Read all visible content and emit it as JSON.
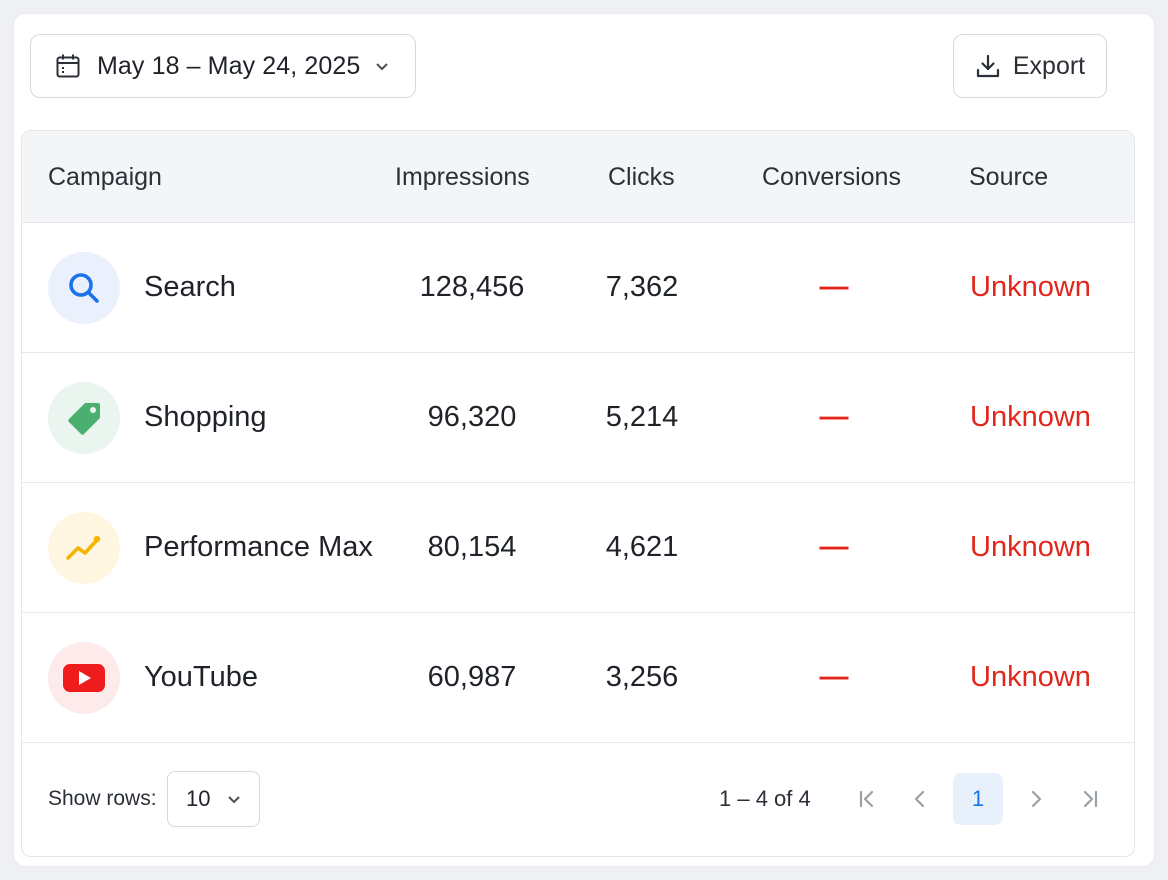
{
  "toolbar": {
    "date_range": "May 18 – May 24, 2025",
    "export_label": "Export"
  },
  "table": {
    "columns": [
      "Campaign",
      "Impressions",
      "Clicks",
      "Conversions",
      "Source"
    ],
    "rows": [
      {
        "icon": "search-icon",
        "campaign": "Search",
        "impressions": "128,456",
        "clicks": "7,362",
        "conversions": "—",
        "source": "Unknown"
      },
      {
        "icon": "tag-icon",
        "campaign": "Shopping",
        "impressions": "96,320",
        "clicks": "5,214",
        "conversions": "—",
        "source": "Unknown"
      },
      {
        "icon": "trending-up-icon",
        "campaign": "Performance Max",
        "impressions": "80,154",
        "clicks": "4,621",
        "conversions": "—",
        "source": "Unknown"
      },
      {
        "icon": "youtube-play-icon",
        "campaign": "YouTube",
        "impressions": "60,987",
        "clicks": "3,256",
        "conversions": "—",
        "source": "Unknown"
      }
    ]
  },
  "footer": {
    "show_rows_label": "Show rows:",
    "rows_value": "10",
    "range_text": "1 – 4 of 4",
    "current_page": "1"
  },
  "colors": {
    "accent_blue": "#1a73e8",
    "error_red": "#e3261c",
    "tag_green": "#4caf72",
    "trend_yellow": "#f5b400",
    "youtube_red": "#ee1c1c"
  }
}
